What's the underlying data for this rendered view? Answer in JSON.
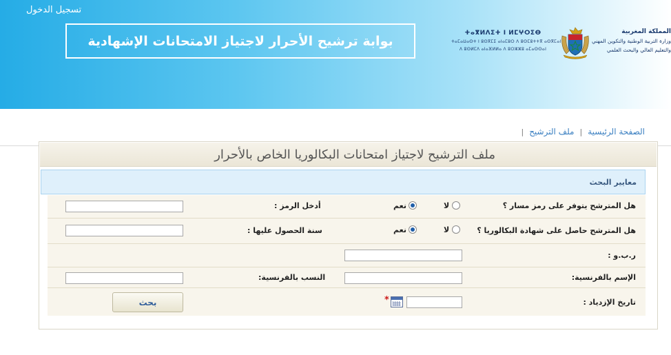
{
  "header": {
    "login_link": "تسجيل الدخول",
    "portal_title": "بوابة ترشيح الأحرار لاجتياز الامتحانات الإشهادية",
    "tifinagh_line1": "ⵜⴰⴳⵍⴷⵉⵜ ⵏ ⵍⵎⵖⵔⵉⴱ",
    "tifinagh_line2": "ⵜⴰⵎⴰⵡⴰⵙⵜ ⵏ ⵓⵙⴳⵎⵉ ⴰⵏⴰⵎⵓⵔ ⴷ ⵓⵙⵎⵓⵜⵜⴳ ⴰⵙⴳⵎⴰⵏ",
    "tifinagh_line3": "ⴷ ⵓⵙⵍⵎⴷ ⴰⵏⴰⴼⵍⵍⴰ ⴷ ⵓⵔⵣⵣⵓ ⴰⵎⴰⵙⵙⴰⵏ",
    "ministry_line1": "المملكة المغربية",
    "ministry_line2": "وزارة التربية الوطنية والتكوين المهني",
    "ministry_line3": "والتعليم العالي والبحث العلمي"
  },
  "breadcrumb": {
    "home": "الصفحة الرئيسية",
    "separator": "|",
    "current": "ملف الترشيح",
    "end_separator": "|"
  },
  "panel": {
    "title": "ملف الترشيح لاجتياز امتحانات البكالوريا الخاص بالأحرار",
    "criteria_header": "معايير البحث"
  },
  "form": {
    "q_massar": "هل المترشح يتوفر على رمز مسار ؟",
    "opt_no": "لا",
    "opt_yes": "نعم",
    "massar_yes_selected": true,
    "code_label": "أدخل الرمز :",
    "code_value": "",
    "q_bac": "هل المترشح حاصل على شهادة البكالوريا ؟",
    "bac_yes_selected": true,
    "year_label": "سنة الحصول عليها :",
    "year_value": "",
    "cin_label": "ر.ب.و :",
    "cin_value": "",
    "firstname_fr_label": "الإسم بالفرنسية:",
    "firstname_fr_value": "",
    "lastname_fr_label": "النسب بالفرنسية:",
    "lastname_fr_value": "",
    "birthdate_label": "تاريخ الإزدياد :",
    "birthdate_value": "",
    "required_mark": "*",
    "search_button": "بحث"
  },
  "colors": {
    "header_blue": "#25ace6",
    "link_blue": "#3a7fc1",
    "criteria_bg": "#dff0fb",
    "row_bg": "#f8f5ec",
    "required_red": "#cc1a1a"
  },
  "icons": [
    "moroccan-coat-of-arms-icon",
    "calendar-icon",
    "radio-selected-icon",
    "radio-unselected-icon"
  ]
}
